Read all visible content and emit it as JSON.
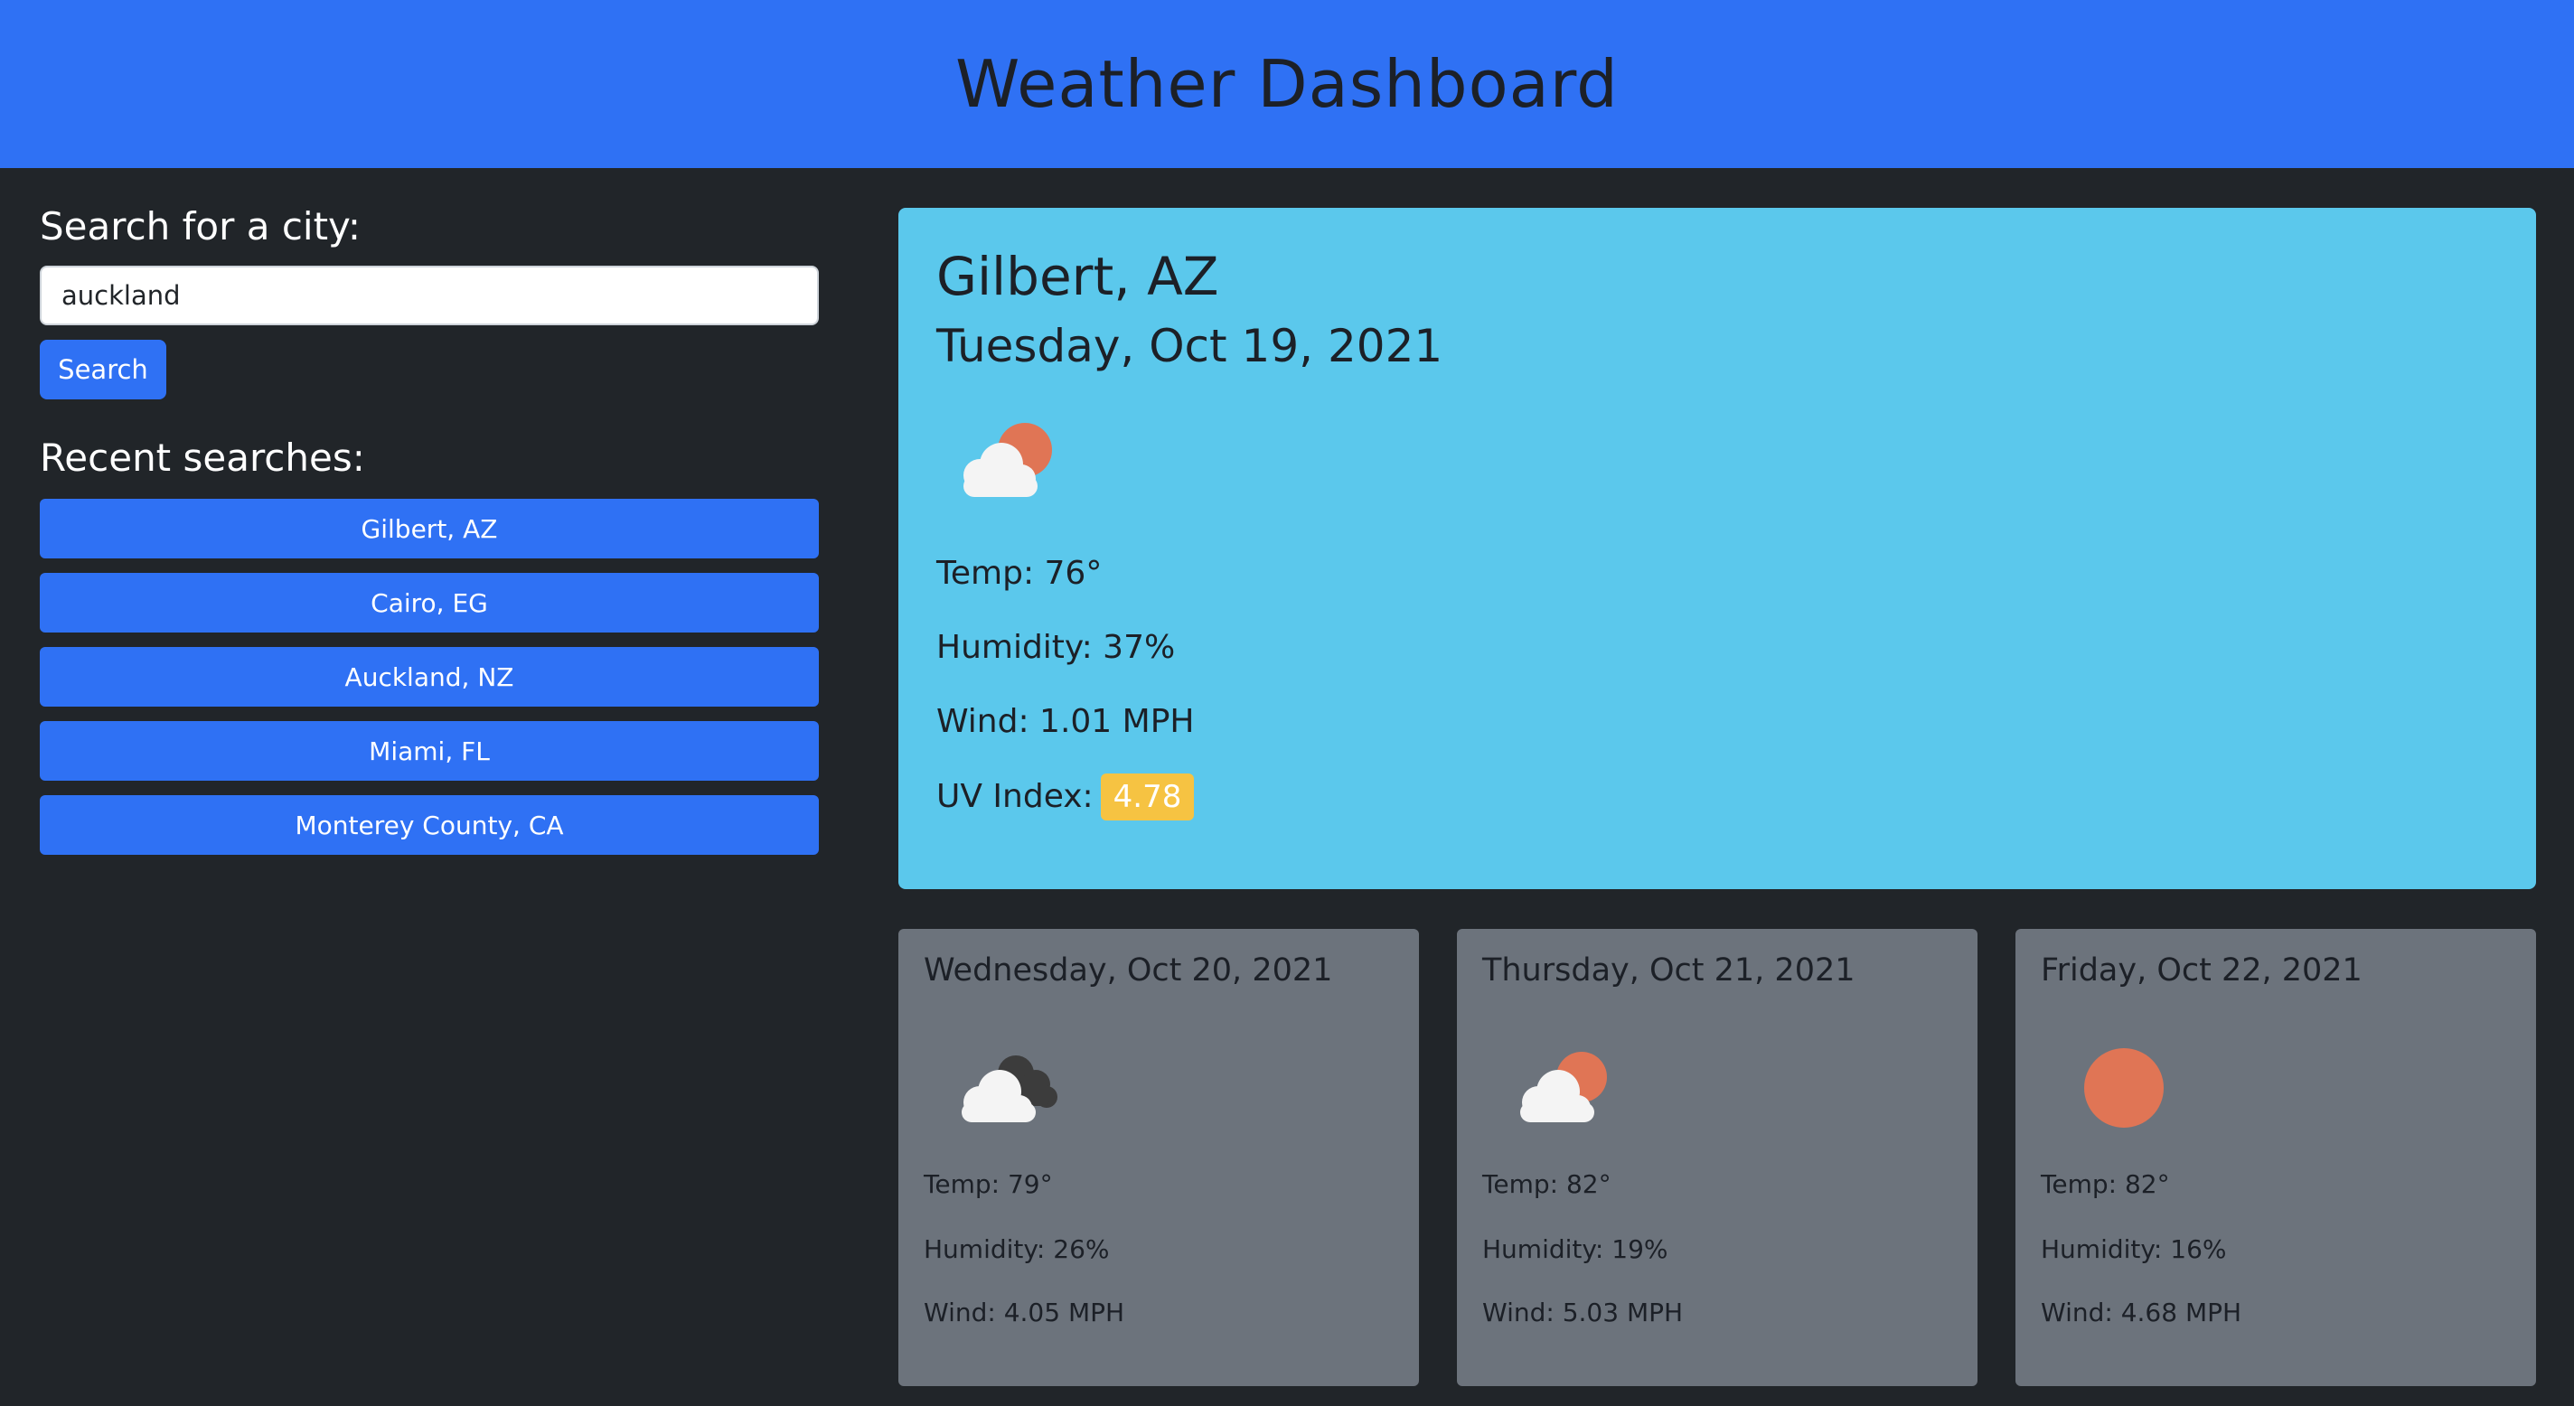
{
  "header": {
    "title": "Weather Dashboard"
  },
  "search": {
    "label": "Search for a city:",
    "value": "auckland",
    "button_label": "Search"
  },
  "recent": {
    "title": "Recent searches:",
    "items": [
      "Gilbert, AZ",
      "Cairo, EG",
      "Auckland, NZ",
      "Miami, FL",
      "Monterey County, CA"
    ]
  },
  "current": {
    "city": "Gilbert, AZ",
    "date": "Tuesday, Oct 19, 2021",
    "icon": "partly-cloudy-icon",
    "temp": "Temp: 76°",
    "humidity": "Humidity: 37%",
    "wind": "Wind: 1.01 MPH",
    "uv_label": "UV Index:",
    "uv_value": "4.78"
  },
  "forecast": [
    {
      "date": "Wednesday, Oct 20, 2021",
      "icon": "broken-clouds-icon",
      "temp": "Temp: 79°",
      "humidity": "Humidity: 26%",
      "wind": "Wind: 4.05 MPH"
    },
    {
      "date": "Thursday, Oct 21, 2021",
      "icon": "partly-cloudy-icon",
      "temp": "Temp: 82°",
      "humidity": "Humidity: 19%",
      "wind": "Wind: 5.03 MPH"
    },
    {
      "date": "Friday, Oct 22, 2021",
      "icon": "sun-icon",
      "temp": "Temp: 82°",
      "humidity": "Humidity: 16%",
      "wind": "Wind: 4.68 MPH"
    }
  ],
  "colors": {
    "header": "#2f71f4",
    "background": "#212529",
    "current_card": "#5bc8ec",
    "forecast_card": "#6c737c",
    "uv_badge": "#f6c342",
    "sun": "#e07555"
  }
}
